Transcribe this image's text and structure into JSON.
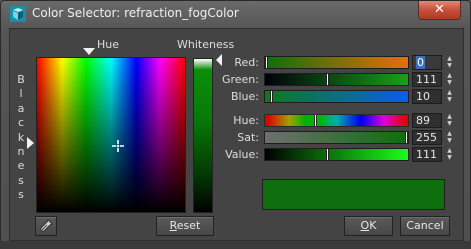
{
  "window": {
    "title": "Color Selector: refraction_fogColor",
    "close_glyph": "✕"
  },
  "field": {
    "hue_label": "Hue",
    "whiteness_label": "Whiteness",
    "blackness_label": "Blackness"
  },
  "channels": [
    {
      "key": "red",
      "label": "Red:",
      "value": "0",
      "level": 0.0
    },
    {
      "key": "green",
      "label": "Green:",
      "value": "111",
      "level": 0.435
    },
    {
      "key": "blue",
      "label": "Blue:",
      "value": "10",
      "level": 0.039
    },
    {
      "key": "hue",
      "label": "Hue:",
      "value": "89",
      "level": 0.349
    },
    {
      "key": "sat",
      "label": "Sat:",
      "value": "255",
      "level": 1.0
    },
    {
      "key": "value",
      "label": "Value:",
      "value": "111",
      "level": 0.435
    }
  ],
  "preview_color": "#0d6f0d",
  "buttons": {
    "reset": "Reset",
    "reset_accel": "R",
    "ok": "OK",
    "ok_accel": "O",
    "cancel": "Cancel"
  },
  "spin_glyphs": {
    "up": "▲",
    "down": "▼"
  }
}
